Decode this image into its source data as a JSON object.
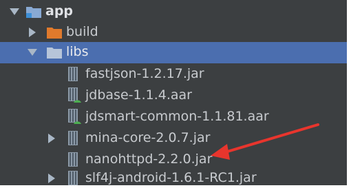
{
  "tree": {
    "root": {
      "label": "app",
      "expanded": true,
      "icon": "module-folder-icon"
    },
    "build": {
      "label": "build",
      "expanded": false,
      "icon": "orange-folder-icon"
    },
    "libs": {
      "label": "libs",
      "expanded": true,
      "selected": true,
      "icon": "folder-icon"
    },
    "files": [
      {
        "label": "fastjson-1.2.17.jar",
        "icon": "jar-icon",
        "expandable": false
      },
      {
        "label": "jdbase-1.1.4.aar",
        "icon": "aar-icon",
        "expandable": false
      },
      {
        "label": "jdsmart-common-1.1.81.aar",
        "icon": "aar-icon",
        "expandable": false
      },
      {
        "label": "mina-core-2.0.7.jar",
        "icon": "jar-icon",
        "expandable": true
      },
      {
        "label": "nanohttpd-2.2.0.jar",
        "icon": "jar-icon",
        "expandable": false
      },
      {
        "label": "slf4j-android-1.6.1-RC1.jar",
        "icon": "jar-icon",
        "expandable": true
      }
    ]
  },
  "annotation": {
    "type": "red-arrow",
    "color": "#e8352d",
    "points_to": "nanohttpd-2.2.0.jar"
  },
  "colors": {
    "background": "#3c3f41",
    "selection": "#4b6eaf",
    "text": "#c8cbcf",
    "folder_orange": "#e07a2c",
    "folder_blue": "#88a9d3"
  }
}
